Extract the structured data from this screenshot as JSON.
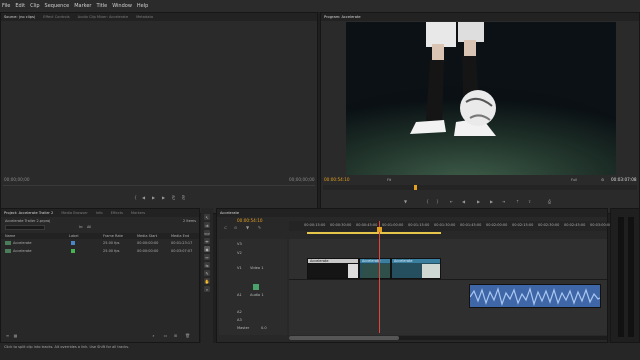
{
  "menu": [
    "File",
    "Edit",
    "Clip",
    "Sequence",
    "Marker",
    "Title",
    "Window",
    "Help"
  ],
  "source": {
    "tabs": [
      "Source: (no clips)",
      "Effect Controls",
      "Audio Clip Mixer: Accelerate",
      "Metadata"
    ],
    "timecode_left": "00;00;00;00",
    "timecode_right": "00;00;00;00"
  },
  "program": {
    "tab": "Program: Accelerate",
    "timecode_current": "00:00:54:10",
    "fit": "Fit",
    "quality": "Full",
    "duration": "00:03:07:08"
  },
  "project": {
    "tabs": [
      "Project: Accelerate Trailer 2",
      "Media Browser",
      "Info",
      "Effects",
      "Markers"
    ],
    "subtitle": "Accelerate Trailer 2.prproj",
    "item_count": "2 Items",
    "search_label": "In:",
    "search_value": "All",
    "columns": [
      "Name",
      "Label",
      "Frame Rate",
      "Media Start",
      "Media End"
    ],
    "rows": [
      {
        "name": "Accelerate",
        "label_color": "#4a86c8",
        "rate": "25.00 fps",
        "start": "00:00:00:00",
        "end": "00:01:23:17"
      },
      {
        "name": "Accelerate",
        "label_color": "#46b450",
        "rate": "25.00 fps",
        "start": "00:00:00:00",
        "end": "00:03:07:07"
      }
    ]
  },
  "timeline": {
    "tab": "Accelerate",
    "timecode": "00:00:54:10",
    "ruler": [
      "00:00:15:00",
      "00:00:30:00",
      "00:00:45:00",
      "00:01:00:00",
      "00:01:15:00",
      "00:01:30:00",
      "00:01:45:00",
      "00:02:00:00",
      "00:02:15:00",
      "00:02:30:00",
      "00:02:45:00",
      "00:03:00:00"
    ],
    "tracks": [
      "V3",
      "V2",
      "V1",
      "A1",
      "A2",
      "A3",
      "Master"
    ],
    "track_name_video": "Video 1",
    "track_name_audio": "Audio 1",
    "master_value": "0.0",
    "clips": {
      "v1a": "Accelerate",
      "v1b": "Accelerate",
      "v1c": "Accelerate"
    }
  },
  "status_bar": "Click to split clip into tracks. Alt overrides a link. Use Shift for all tracks.",
  "colors": {
    "accent": "#e6a020",
    "audio": "#5b8ad0",
    "video_clip": "#2e6f8a"
  }
}
